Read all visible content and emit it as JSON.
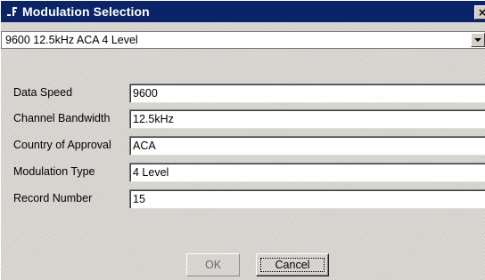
{
  "window": {
    "title": "Modulation Selection",
    "system_icon": "window-menu-icon",
    "close_label": "×"
  },
  "selection": {
    "value": "9600 12.5kHz ACA 4 Level"
  },
  "fields": [
    {
      "label": "Data Speed",
      "value": "9600"
    },
    {
      "label": "Channel Bandwidth",
      "value": "12.5kHz"
    },
    {
      "label": "Country of Approval",
      "value": "ACA"
    },
    {
      "label": "Modulation Type",
      "value": "4 Level"
    },
    {
      "label": "Record Number",
      "value": "15"
    }
  ],
  "buttons": {
    "ok": "OK",
    "cancel": "Cancel"
  },
  "colors": {
    "titlebar": "#0a246a",
    "dialog_bg": "#d6d3ce"
  }
}
